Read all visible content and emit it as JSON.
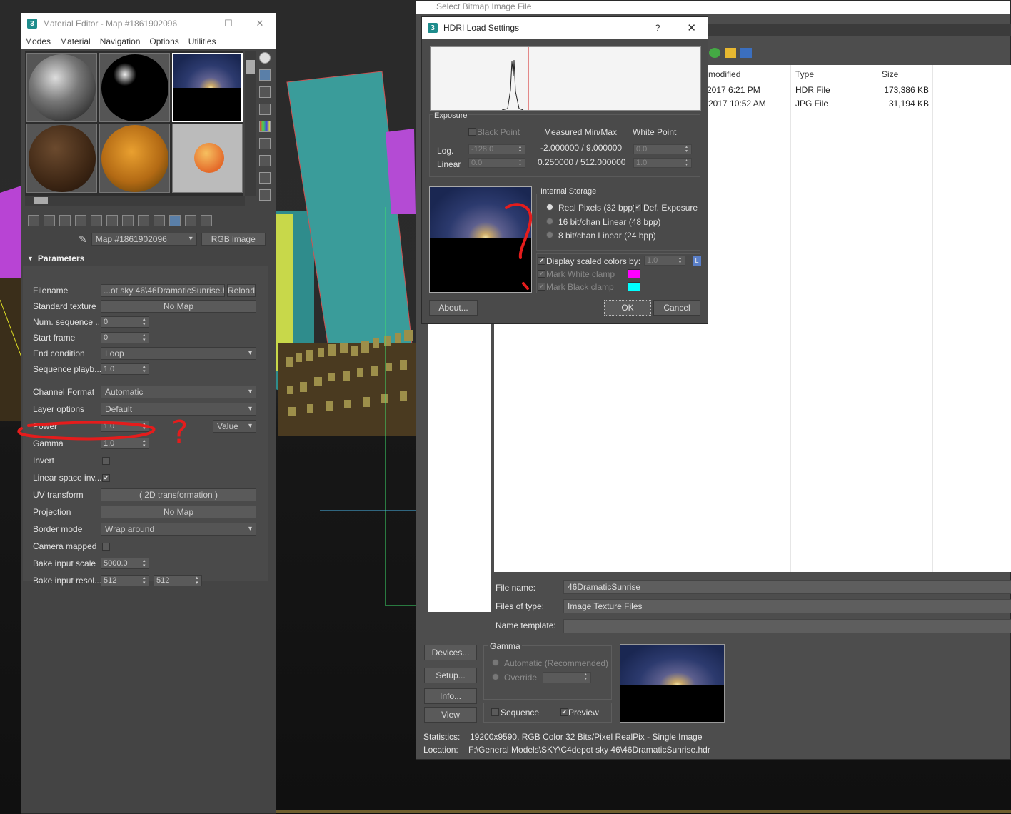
{
  "material_editor": {
    "title": "Material Editor - Map #1861902096",
    "menus": [
      "Modes",
      "Material",
      "Navigation",
      "Options",
      "Utilities"
    ],
    "map_name": "Map #1861902096",
    "map_type_button": "RGB image",
    "rollout_title": "Parameters",
    "params": {
      "filename_label": "Filename",
      "filename_value": "...ot sky 46\\46DramaticSunrise.hdr",
      "reload_button": "Reload",
      "standard_texture_label": "Standard texture",
      "standard_texture_value": "No Map",
      "num_sequence_label": "Num. sequence ...",
      "num_sequence_value": "0",
      "start_frame_label": "Start frame",
      "start_frame_value": "0",
      "end_condition_label": "End condition",
      "end_condition_value": "Loop",
      "sequence_playback_label": "Sequence playb...",
      "sequence_playback_value": "1.0",
      "channel_format_label": "Channel Format",
      "channel_format_value": "Automatic",
      "layer_options_label": "Layer options",
      "layer_options_value": "Default",
      "power_label": "Power",
      "power_value": "1.0",
      "power_mode": "Value",
      "gamma_label": "Gamma",
      "gamma_value": "1.0",
      "invert_label": "Invert",
      "linear_space_label": "Linear space inv...",
      "linear_space_check": "✔",
      "uv_transform_label": "UV transform",
      "uv_transform_value": "( 2D transformation )",
      "projection_label": "Projection",
      "projection_value": "No Map",
      "border_mode_label": "Border mode",
      "border_mode_value": "Wrap around",
      "camera_mapped_label": "Camera mapped",
      "bake_scale_label": "Bake input scale",
      "bake_scale_value": "5000.0",
      "bake_res_label": "Bake input resol...",
      "bake_res_x": "512",
      "bake_res_y": "512"
    },
    "annotation_mark": "?"
  },
  "file_dialog": {
    "title": "Select Bitmap Image File",
    "columns": [
      "e modified",
      "Type",
      "Size"
    ],
    "rows": [
      {
        "modified": "2017 6:21 PM",
        "type": "HDR File",
        "size": "173,386 KB"
      },
      {
        "modified": "3/2017 10:52 AM",
        "type": "JPG File",
        "size": "31,194 KB"
      }
    ],
    "file_name_label": "File name:",
    "file_name_value": "46DramaticSunrise",
    "files_of_type_label": "Files of type:",
    "files_of_type_value": "Image Texture Files",
    "name_template_label": "Name template:",
    "buttons": [
      "Devices...",
      "Setup...",
      "Info...",
      "View"
    ],
    "gamma_group": "Gamma",
    "gamma_auto": "Automatic (Recommended)",
    "gamma_override": "Override",
    "sequence_label": "Sequence",
    "preview_label": "Preview",
    "preview_check": "✔",
    "statistics_label": "Statistics:",
    "statistics_value": "19200x9590, RGB Color 32 Bits/Pixel RealPix - Single Image",
    "location_label": "Location:",
    "location_value": "F:\\General Models\\SKY\\C4depot sky 46\\46DramaticSunrise.hdr"
  },
  "hdri_dialog": {
    "title": "HDRI Load Settings",
    "help": "?",
    "close": "✕",
    "exposure_label": "Exposure",
    "black_point_label": "Black Point",
    "measured_label": "Measured Min/Max",
    "white_point_label": "White Point",
    "log_label": "Log.",
    "linear_label": "Linear",
    "black_log": "-128.0",
    "black_linear": "0.0",
    "measured_log": "-2.000000 / 9.000000",
    "measured_linear": "0.250000 / 512.000000",
    "white_log": "0.0",
    "white_linear": "1.0",
    "internal_storage_label": "Internal Storage",
    "opt_real": "Real Pixels (32 bpp)",
    "opt_def_exposure": "Def. Exposure",
    "opt_16": "16 bit/chan Linear (48 bpp)",
    "opt_8": "8 bit/chan Linear (24 bpp)",
    "display_scaled_label": "Display scaled colors by:",
    "display_scaled_value": "1.0",
    "lock_label": "L",
    "mark_white": "Mark White clamp",
    "mark_black": "Mark Black clamp",
    "check": "✔",
    "about_button": "About...",
    "ok_button": "OK",
    "cancel_button": "Cancel",
    "white_clamp_color": "#ff00ff",
    "black_clamp_color": "#00ffff"
  }
}
